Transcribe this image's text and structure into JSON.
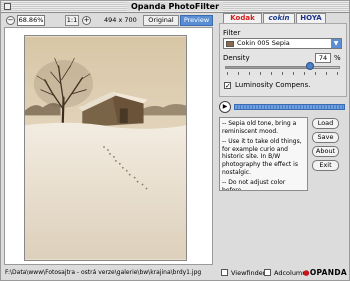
{
  "window": {
    "title": "Opanda PhotoFilter"
  },
  "toolbar": {
    "zoom_out_icon": "minus",
    "zoom_value": "68.86%",
    "zoom_in_icon": "plus",
    "actual_size_label": "1:1",
    "fit_icon": "plus",
    "image_size": "494 x 700",
    "original_label": "Original",
    "preview_label": "Preview"
  },
  "tabs": [
    "Kodak",
    "cokin",
    "HOYA"
  ],
  "filter": {
    "label": "Filter",
    "selected": "Cokin 005 Sepia",
    "swatch_color": "#8a6c4a"
  },
  "density": {
    "label": "Density",
    "value": "74",
    "unit": "%",
    "level_percent": 74
  },
  "luminosity": {
    "label": "Luminosity Compens.",
    "checked": true,
    "check_mark": "✓"
  },
  "progress": {
    "play_icon": "play-icon"
  },
  "description": {
    "lines": [
      "-- Sepia old tone, bring a reminiscent mood.",
      "-- Use it to take old things, for example curio and historic site. In B/W photography the effect is nostalgic.",
      "-- Do not adjust color before..."
    ]
  },
  "buttons": {
    "load": "Load",
    "save": "Save",
    "about": "About",
    "exit": "Exit"
  },
  "status": {
    "path": "F:\\Data\\www\\Fotosajtra - ostrá verze\\galerie\\bw\\krajina\\brdy1.jpg"
  },
  "bottom": {
    "viewfinder_label": "Viewfinder",
    "adcolumn_label": "Adcolumr",
    "logo_text": "OPANDA",
    "logo_mark": "●"
  },
  "colors": {
    "accent": "#5a8ed4",
    "sepia_sky": "#ebe0cc",
    "sepia_ground": "#f4ede2",
    "sepia_dark": "#3a2c1e"
  }
}
